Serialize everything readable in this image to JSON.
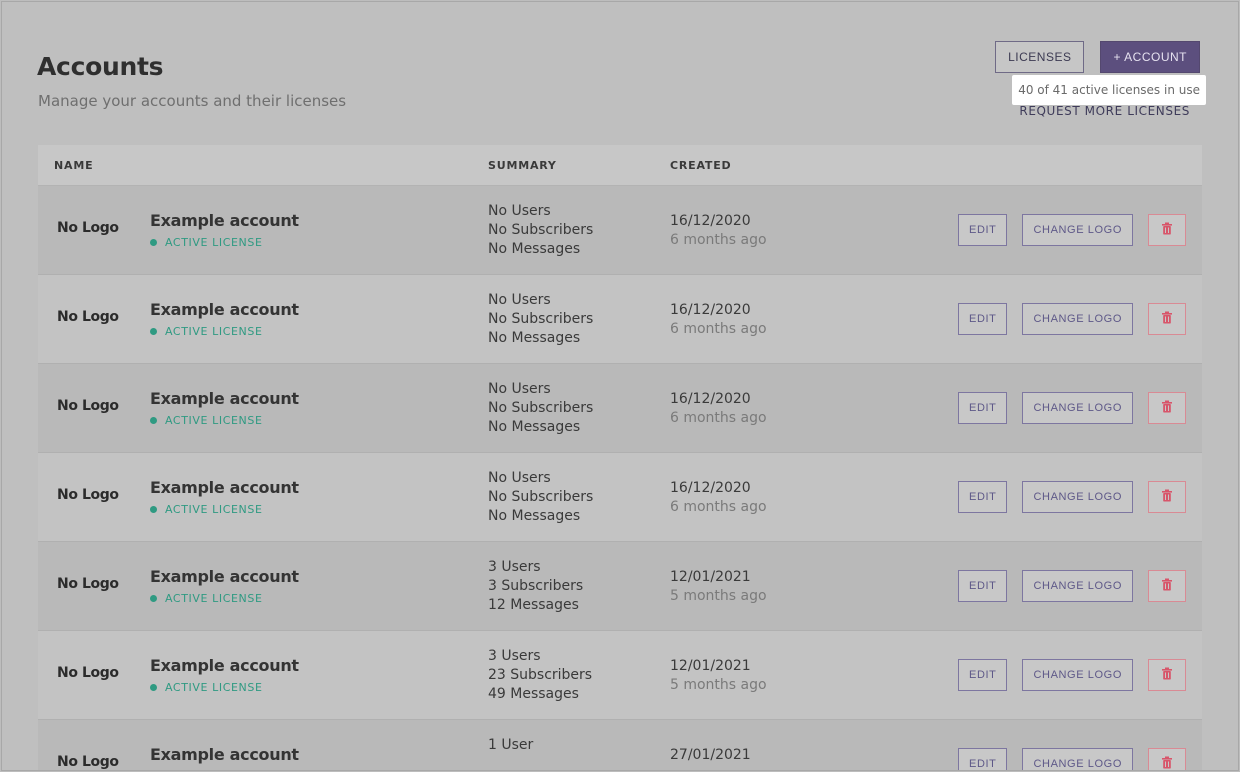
{
  "header": {
    "title": "Accounts",
    "subtitle": "Manage your accounts and their licenses",
    "licenses_button": "LICENSES",
    "add_account_button": "+ ACCOUNT",
    "license_count": "40 of 41 active licenses in use",
    "request_link": "REQUEST MORE LICENSES"
  },
  "table": {
    "columns": {
      "name": "NAME",
      "summary": "SUMMARY",
      "created": "CREATED"
    },
    "rows": [
      {
        "logo": "No Logo",
        "name": "Example account",
        "license": "ACTIVE LICENSE",
        "summary": [
          "No Users",
          "No Subscribers",
          "No Messages"
        ],
        "date": "16/12/2020",
        "ago": "6 months ago"
      },
      {
        "logo": "No Logo",
        "name": "Example account",
        "license": "ACTIVE LICENSE",
        "summary": [
          "No Users",
          "No Subscribers",
          "No Messages"
        ],
        "date": "16/12/2020",
        "ago": "6 months ago"
      },
      {
        "logo": "No Logo",
        "name": "Example account",
        "license": "ACTIVE LICENSE",
        "summary": [
          "No Users",
          "No Subscribers",
          "No Messages"
        ],
        "date": "16/12/2020",
        "ago": "6 months ago"
      },
      {
        "logo": "No Logo",
        "name": "Example account",
        "license": "ACTIVE LICENSE",
        "summary": [
          "No Users",
          "No Subscribers",
          "No Messages"
        ],
        "date": "16/12/2020",
        "ago": "6 months ago"
      },
      {
        "logo": "No Logo",
        "name": "Example account",
        "license": "ACTIVE LICENSE",
        "summary": [
          "3 Users",
          "3 Subscribers",
          "12 Messages"
        ],
        "date": "12/01/2021",
        "ago": "5 months ago"
      },
      {
        "logo": "No Logo",
        "name": "Example account",
        "license": "ACTIVE LICENSE",
        "summary": [
          "3 Users",
          "23 Subscribers",
          "49 Messages"
        ],
        "date": "12/01/2021",
        "ago": "5 months ago"
      },
      {
        "logo": "No Logo",
        "name": "Example account",
        "license": "",
        "summary": [
          "1 User",
          "",
          ""
        ],
        "date": "27/01/2021",
        "ago": ""
      }
    ],
    "actions": {
      "edit": "EDIT",
      "change_logo": "CHANGE LOGO",
      "delete_icon": "trash-icon"
    }
  },
  "colors": {
    "primary": "#5c4f7e",
    "license_green": "#2f9a82",
    "delete_red": "#d98a94"
  }
}
